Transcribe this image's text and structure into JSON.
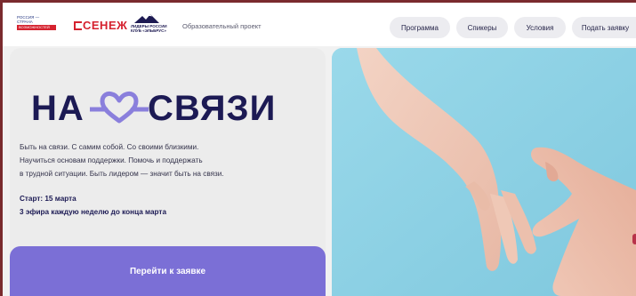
{
  "header": {
    "logos": {
      "rossiya": {
        "line1": "РОССИЯ —",
        "line2": "СТРАНА",
        "line3": "ВОЗМОЖНОСТЕЙ"
      },
      "senezh": "СЕНЕЖ",
      "leaders": {
        "line1": "ЛИДЕРЫ РОССИИ",
        "line2": "КЛУБ «ЭЛЬБРУС»"
      }
    },
    "project_label": "Образовательный проект",
    "nav": [
      "Программа",
      "Спикеры",
      "Условия",
      "Подать заявку"
    ]
  },
  "hero": {
    "title_left": "НА",
    "title_right": "СВЯЗИ",
    "description": [
      "Быть на связи. С самим собой. Со своими близкими.",
      "Научиться основам поддержки. Помочь и поддержать",
      "в трудной ситуации. Быть лидером — значит быть на связи."
    ],
    "start": "Старт: 15 марта",
    "schedule": "3 эфира каждую неделю до конца марта",
    "cta": "Перейти к заявке"
  },
  "colors": {
    "accent": "#7b6fd6",
    "title": "#1c1a54",
    "heart": "#8a7fdc",
    "photo_bg": "#8ed3e6",
    "brand_red": "#d5222f",
    "frame": "#7a2b2e"
  }
}
